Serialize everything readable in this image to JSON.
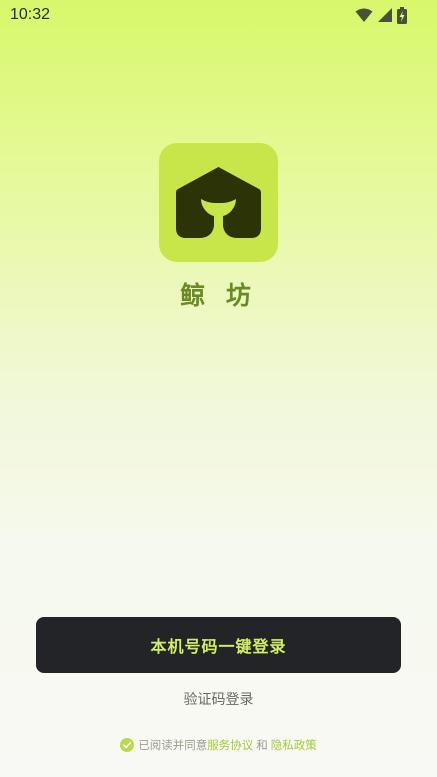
{
  "status_bar": {
    "time": "10:32",
    "icons": [
      "wifi-icon",
      "cellular-signal-icon",
      "battery-charging-icon"
    ]
  },
  "app": {
    "name": "鲸 坊",
    "logo_icon": "whale-tail-house-icon"
  },
  "login": {
    "one_tap_label": "本机号码一键登录",
    "code_login_label": "验证码登录"
  },
  "agreement": {
    "prefix": "已阅读并同意",
    "service_link": "服务协议",
    "conjunction": "和",
    "privacy_link": "隐私政策",
    "checked": true
  },
  "colors": {
    "accent": "#C8E64A",
    "brand_text": "#6B8A25",
    "button_bg": "#222428",
    "button_text": "#D2EF65",
    "link": "#A6C93D"
  }
}
